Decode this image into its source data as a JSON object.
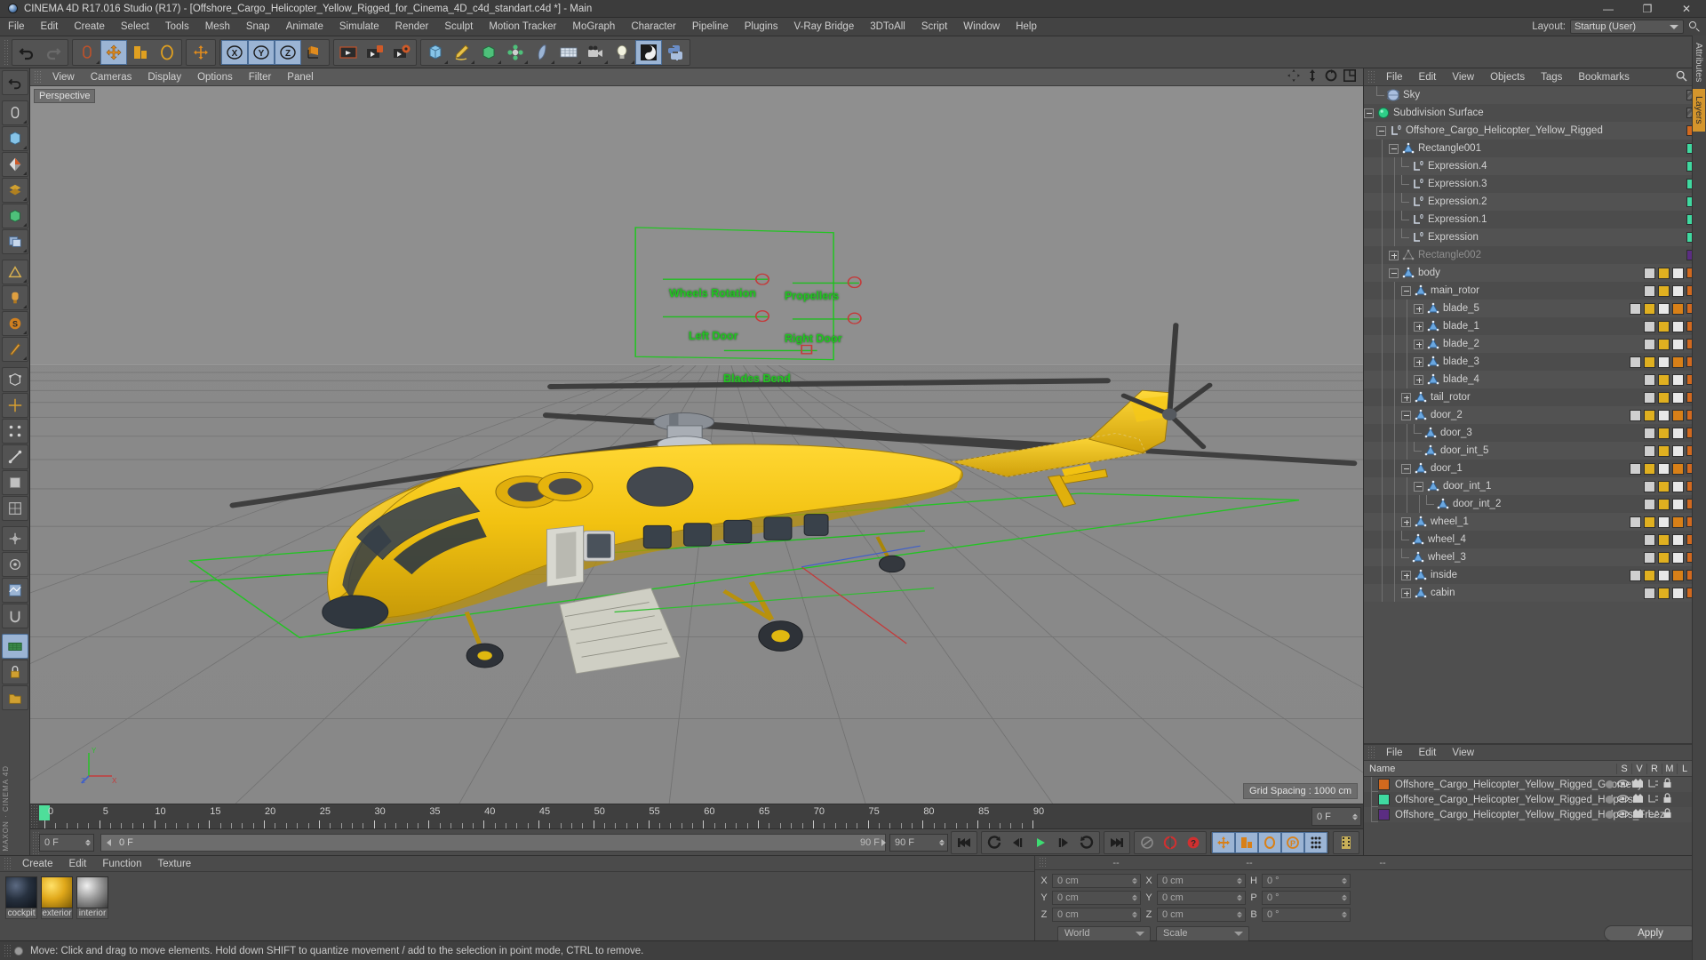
{
  "window": {
    "title": "CINEMA 4D R17.016 Studio (R17) - [Offshore_Cargo_Helicopter_Yellow_Rigged_for_Cinema_4D_c4d_standart.c4d *] - Main",
    "minimize": "—",
    "maximize": "❐",
    "close": "✕"
  },
  "menubar": {
    "items": [
      "File",
      "Edit",
      "Create",
      "Select",
      "Tools",
      "Mesh",
      "Snap",
      "Animate",
      "Simulate",
      "Render",
      "Sculpt",
      "Motion Tracker",
      "MoGraph",
      "Character",
      "Pipeline",
      "Plugins",
      "V-Ray Bridge",
      "3DToAll",
      "Script",
      "Window",
      "Help"
    ],
    "layout_label": "Layout:",
    "layout_value": "Startup (User)"
  },
  "viewport": {
    "menu": [
      "View",
      "Cameras",
      "Display",
      "Options",
      "Filter",
      "Panel"
    ],
    "view_label": "Perspective",
    "grid_info": "Grid Spacing : 1000 cm",
    "hud_controls": [
      {
        "label": "Wheels Rotation"
      },
      {
        "label": "Propellers"
      },
      {
        "label": "Left Door"
      },
      {
        "label": "Right Door"
      },
      {
        "label": "Blades Bend"
      }
    ],
    "axis_labels": {
      "x": "X",
      "y": "Y",
      "z": "Z"
    }
  },
  "object_manager": {
    "menu": [
      "File",
      "Edit",
      "View",
      "Objects",
      "Tags",
      "Bookmarks"
    ],
    "rows": [
      {
        "label": "Sky",
        "depth": 1,
        "icon": "sky",
        "expander": "none",
        "chip": "none",
        "dots": "red"
      },
      {
        "label": "Subdivision Surface",
        "depth": 0,
        "icon": "subdiv",
        "expander": "minus",
        "chip": "none",
        "dots": "plain"
      },
      {
        "label": "Offshore_Cargo_Helicopter_Yellow_Rigged",
        "depth": 1,
        "icon": "null",
        "expander": "minus",
        "chip": "#d2691e",
        "dots": "plain"
      },
      {
        "label": "Rectangle001",
        "depth": 2,
        "icon": "spline",
        "expander": "minus",
        "chip": "#3fd9a0",
        "dots": "red"
      },
      {
        "label": "Expression.4",
        "depth": 3,
        "icon": "null",
        "expander": "none",
        "chip": "#3fd9a0",
        "dots": "plain"
      },
      {
        "label": "Expression.3",
        "depth": 3,
        "icon": "null",
        "expander": "none",
        "chip": "#3fd9a0",
        "dots": "plain"
      },
      {
        "label": "Expression.2",
        "depth": 3,
        "icon": "null",
        "expander": "none",
        "chip": "#3fd9a0",
        "dots": "plain"
      },
      {
        "label": "Expression.1",
        "depth": 3,
        "icon": "null",
        "expander": "none",
        "chip": "#3fd9a0",
        "dots": "plain"
      },
      {
        "label": "Expression",
        "depth": 3,
        "icon": "null",
        "expander": "none",
        "chip": "#3fd9a0",
        "dots": "plain"
      },
      {
        "label": "Rectangle002",
        "depth": 2,
        "icon": "spline-dim",
        "expander": "plus",
        "chip": "#5b2d82",
        "dots": "plain",
        "dim": true
      },
      {
        "label": "body",
        "depth": 2,
        "icon": "mesh",
        "expander": "minus",
        "chip": "#d2691e",
        "dots": "green"
      },
      {
        "label": "main_rotor",
        "depth": 3,
        "icon": "mesh",
        "expander": "minus",
        "chip": "#d2691e",
        "dots": "plain"
      },
      {
        "label": "blade_5",
        "depth": 4,
        "icon": "mesh",
        "expander": "plus",
        "chip": "#d2691e",
        "dots": "plain"
      },
      {
        "label": "blade_1",
        "depth": 4,
        "icon": "mesh",
        "expander": "plus",
        "chip": "#d2691e",
        "dots": "plain"
      },
      {
        "label": "blade_2",
        "depth": 4,
        "icon": "mesh",
        "expander": "plus",
        "chip": "#d2691e",
        "dots": "plain"
      },
      {
        "label": "blade_3",
        "depth": 4,
        "icon": "mesh",
        "expander": "plus",
        "chip": "#d2691e",
        "dots": "plain"
      },
      {
        "label": "blade_4",
        "depth": 4,
        "icon": "mesh",
        "expander": "plus",
        "chip": "#d2691e",
        "dots": "plain"
      },
      {
        "label": "tail_rotor",
        "depth": 3,
        "icon": "mesh",
        "expander": "plus",
        "chip": "#d2691e",
        "dots": "plain"
      },
      {
        "label": "door_2",
        "depth": 3,
        "icon": "mesh",
        "expander": "minus",
        "chip": "#d2691e",
        "dots": "plain"
      },
      {
        "label": "door_3",
        "depth": 4,
        "icon": "mesh",
        "expander": "none",
        "chip": "#d2691e",
        "dots": "plain"
      },
      {
        "label": "door_int_5",
        "depth": 4,
        "icon": "mesh",
        "expander": "none",
        "chip": "#d2691e",
        "dots": "plain"
      },
      {
        "label": "door_1",
        "depth": 3,
        "icon": "mesh",
        "expander": "minus",
        "chip": "#d2691e",
        "dots": "plain"
      },
      {
        "label": "door_int_1",
        "depth": 4,
        "icon": "mesh",
        "expander": "minus",
        "chip": "#d2691e",
        "dots": "plain"
      },
      {
        "label": "door_int_2",
        "depth": 5,
        "icon": "mesh",
        "expander": "none",
        "chip": "#d2691e",
        "dots": "plain"
      },
      {
        "label": "wheel_1",
        "depth": 3,
        "icon": "mesh",
        "expander": "plus",
        "chip": "#d2691e",
        "dots": "plain"
      },
      {
        "label": "wheel_4",
        "depth": 3,
        "icon": "mesh",
        "expander": "none",
        "chip": "#d2691e",
        "dots": "plain"
      },
      {
        "label": "wheel_3",
        "depth": 3,
        "icon": "mesh",
        "expander": "none",
        "chip": "#d2691e",
        "dots": "plain"
      },
      {
        "label": "inside",
        "depth": 3,
        "icon": "mesh",
        "expander": "plus",
        "chip": "#d2691e",
        "dots": "plain"
      },
      {
        "label": "cabin",
        "depth": 3,
        "icon": "mesh",
        "expander": "plus",
        "chip": "#d2691e",
        "dots": "plain"
      }
    ]
  },
  "layers": {
    "menu": [
      "File",
      "Edit",
      "View"
    ],
    "columns": [
      "Name",
      "S",
      "V",
      "R",
      "M",
      "L"
    ],
    "rows": [
      {
        "name": "Offshore_Cargo_Helicopter_Yellow_Rigged_Geometry",
        "color": "#d2691e"
      },
      {
        "name": "Offshore_Cargo_Helicopter_Yellow_Rigged_Helpers",
        "color": "#3fd9a0"
      },
      {
        "name": "Offshore_Cargo_Helicopter_Yellow_Rigged_Helpers_Freeze",
        "color": "#5b2d82"
      }
    ]
  },
  "side_tabs": [
    {
      "label": "Attributes",
      "active": false
    },
    {
      "label": "Layers",
      "active": true
    }
  ],
  "timeline": {
    "ticks": [
      0,
      5,
      10,
      15,
      20,
      25,
      30,
      35,
      40,
      45,
      50,
      55,
      60,
      65,
      70,
      75,
      80,
      85,
      90
    ],
    "start_field": "0 F",
    "end_field": "0 F",
    "current_frame": "0 F",
    "range_end": "90 F",
    "range_end_field": "90 F",
    "playhead_frame": 0
  },
  "material_manager": {
    "menu": [
      "Create",
      "Edit",
      "Function",
      "Texture"
    ],
    "materials": [
      {
        "name": "cockpit",
        "preview": "dark"
      },
      {
        "name": "exterior",
        "preview": "yellow"
      },
      {
        "name": "interior",
        "preview": "gray"
      }
    ]
  },
  "coordinates": {
    "headers": [
      "--",
      "--",
      "--"
    ],
    "position": {
      "x_label": "X",
      "x_value": "0 cm",
      "y_label": "Y",
      "y_value": "0 cm",
      "z_label": "Z",
      "z_value": "0 cm"
    },
    "size": {
      "x_label": "X",
      "x_value": "0 cm",
      "y_label": "Y",
      "y_value": "0 cm",
      "z_label": "Z",
      "z_value": "0 cm"
    },
    "rotation": {
      "h_label": "H",
      "h_value": "0 °",
      "p_label": "P",
      "p_value": "0 °",
      "b_label": "B",
      "b_value": "0 °"
    },
    "system": "World",
    "mode": "Scale",
    "apply": "Apply"
  },
  "statusbar": {
    "message": "Move: Click and drag to move elements. Hold down SHIFT to quantize movement / add to the selection in point mode, CTRL to remove."
  },
  "branding": {
    "vendor": "MAXON",
    "product": "CINEMA 4D"
  },
  "colors": {
    "accent_orange": "#d2691e",
    "accent_green": "#3fd9a0",
    "accent_purple": "#5b2d82",
    "hud_green": "#23c423",
    "hud_red": "#c43a3a",
    "helicopter_yellow": "#f0c014",
    "selection_blue": "#9bb4d4",
    "play_green": "#3ddc72"
  }
}
